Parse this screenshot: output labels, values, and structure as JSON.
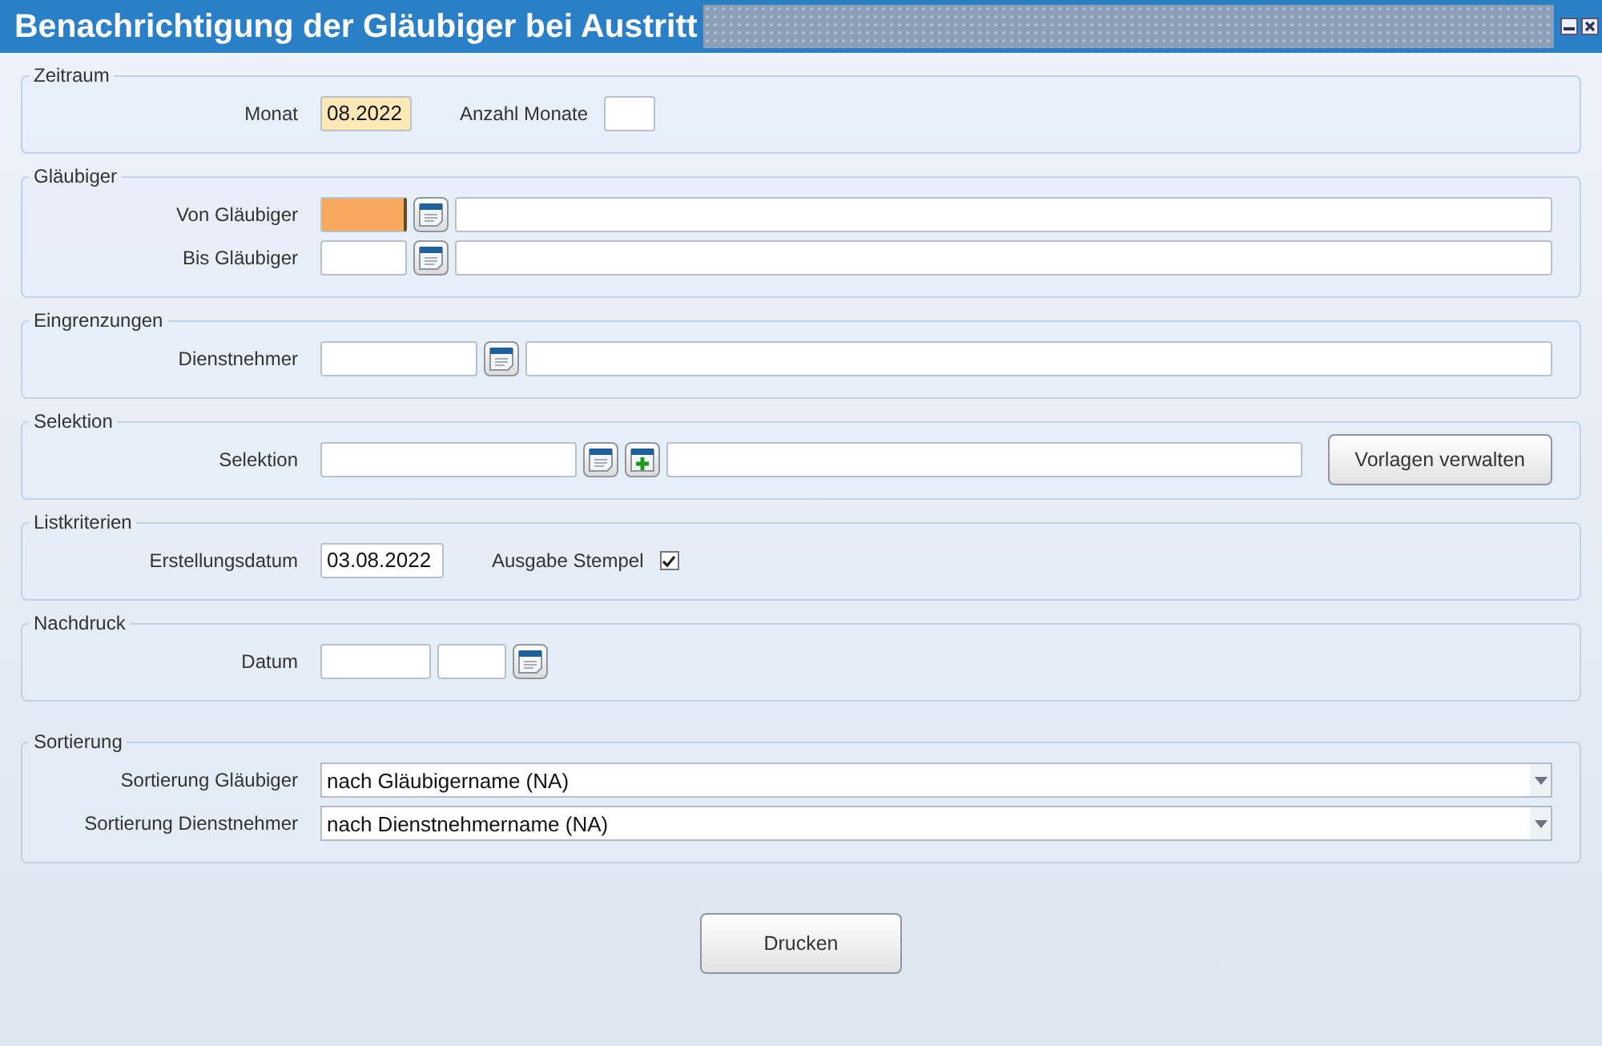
{
  "window": {
    "title": "Benachrichtigung der Gläubiger bei Austritt"
  },
  "sections": [
    {
      "legend": "Zeitraum",
      "rows": [
        {
          "label": "Monat",
          "controls": [
            {
              "kind": "month",
              "value": "08.2022",
              "required": true,
              "focused": false
            },
            {
              "kind": "label",
              "text": "Anzahl Monate"
            },
            {
              "kind": "count",
              "required": false,
              "focused": false
            }
          ]
        }
      ]
    },
    {
      "legend": "Gläubiger",
      "rows": [
        {
          "label": "Von Gläubiger",
          "controls": [
            {
              "kind": "code",
              "required": false,
              "focused": true
            },
            {
              "kind": "lookup"
            },
            {
              "kind": "name",
              "required": false,
              "focused": false
            }
          ]
        },
        {
          "label": "Bis Gläubiger",
          "controls": [
            {
              "kind": "code",
              "required": false,
              "focused": false
            },
            {
              "kind": "lookup"
            },
            {
              "kind": "name",
              "required": false,
              "focused": false
            }
          ]
        }
      ]
    },
    {
      "legend": "Eingrenzungen",
      "rows": [
        {
          "label": "Dienstnehmer",
          "controls": [
            {
              "kind": "id",
              "required": false,
              "focused": false
            },
            {
              "kind": "lookup"
            },
            {
              "kind": "name",
              "required": false,
              "focused": false
            }
          ]
        }
      ]
    },
    {
      "legend": "Selektion",
      "rows": [
        {
          "label": "Selektion",
          "controls": [
            {
              "kind": "selection",
              "required": false,
              "focused": false
            },
            {
              "kind": "lookup"
            },
            {
              "kind": "add"
            },
            {
              "kind": "name",
              "required": false,
              "focused": false
            },
            {
              "kind": "button",
              "text": "Vorlagen verwalten"
            }
          ]
        }
      ]
    },
    {
      "legend": "Listkriterien",
      "rows": [
        {
          "label": "Erstellungsdatum",
          "controls": [
            {
              "kind": "date",
              "value": "03.08.2022",
              "required": false,
              "focused": false
            },
            {
              "kind": "label",
              "text": "Ausgabe Stempel"
            },
            {
              "kind": "checkbox",
              "checked": true
            }
          ]
        }
      ]
    },
    {
      "legend": "Nachdruck",
      "rows": [
        {
          "label": "Datum",
          "controls": [
            {
              "kind": "day",
              "required": false,
              "focused": false
            },
            {
              "kind": "time",
              "required": false,
              "focused": false
            },
            {
              "kind": "lookup"
            }
          ]
        }
      ]
    },
    {
      "legend": "Sortierung",
      "rows": [
        {
          "label": "Sortierung Gläubiger",
          "controls": [
            {
              "kind": "select",
              "value": "nach Gläubigername (NA)"
            }
          ]
        },
        {
          "label": "Sortierung Dienstnehmer",
          "controls": [
            {
              "kind": "select",
              "value": "nach Dienstnehmername (NA)"
            }
          ]
        }
      ]
    }
  ],
  "print_button": "Drucken"
}
